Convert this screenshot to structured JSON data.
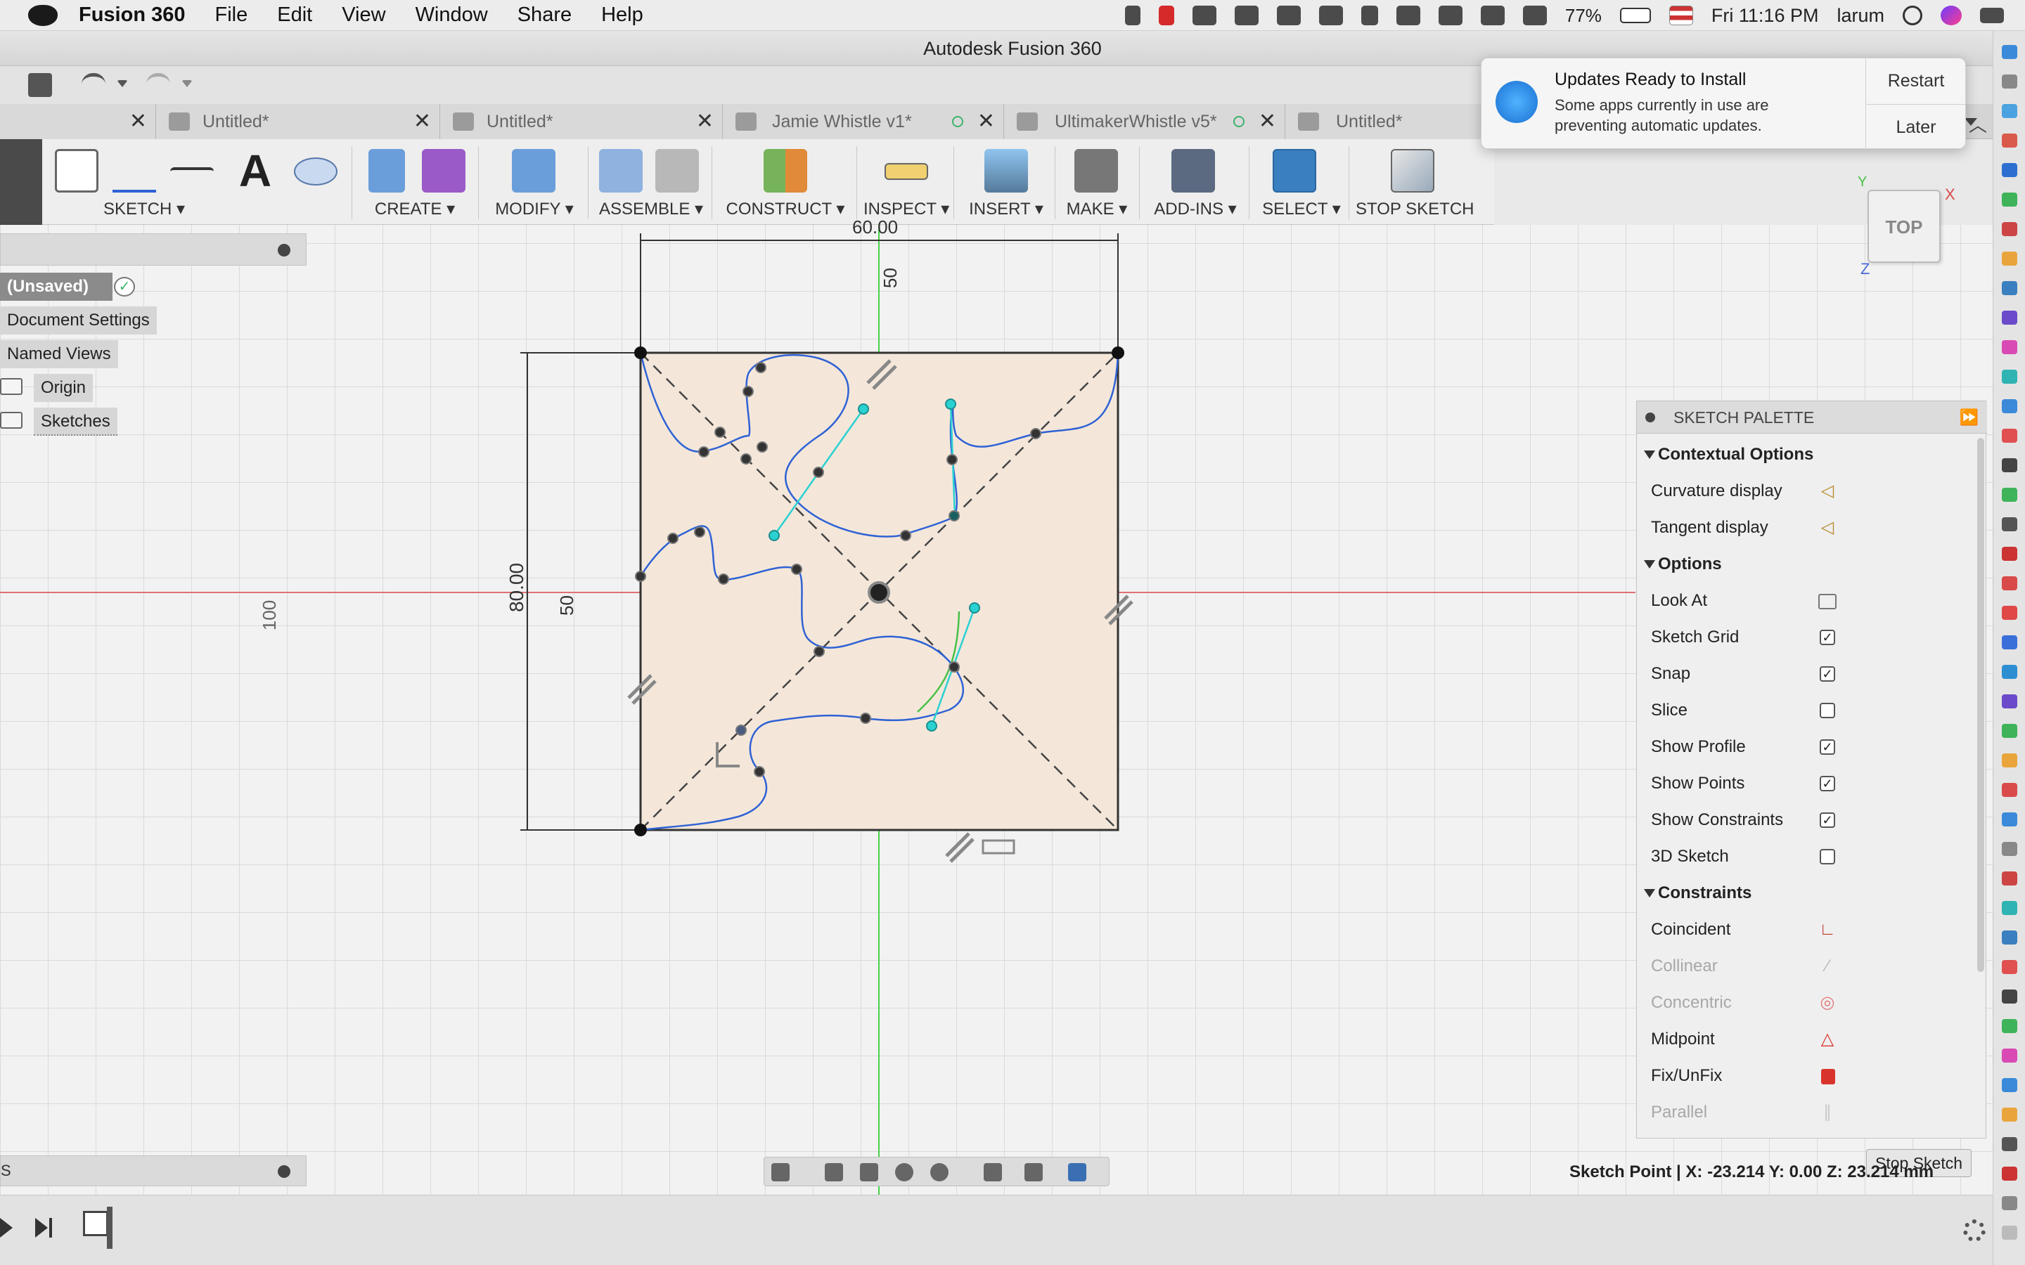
{
  "menubar": {
    "app": "Fusion 360",
    "items": [
      "File",
      "Edit",
      "View",
      "Window",
      "Share",
      "Help"
    ],
    "battery": "77%",
    "clock": "Fri 11:16 PM",
    "user": "larum"
  },
  "window": {
    "title": "Autodesk Fusion 360"
  },
  "tabs": [
    {
      "label": "Untitled*"
    },
    {
      "label": "Untitled*"
    },
    {
      "label": "Jamie Whistle v1*"
    },
    {
      "label": "UltimakerWhistle v5*"
    },
    {
      "label": "Untitled*"
    }
  ],
  "ribbon": {
    "groups": [
      "SKETCH ▾",
      "CREATE ▾",
      "MODIFY ▾",
      "ASSEMBLE ▾",
      "CONSTRUCT ▾",
      "INSPECT ▾",
      "INSERT ▾",
      "MAKE ▾",
      "ADD-INS ▾",
      "SELECT ▾",
      "STOP SKETCH"
    ]
  },
  "notification": {
    "title": "Updates Ready to Install",
    "body": "Some apps currently in use are preventing automatic updates.",
    "restart": "Restart",
    "later": "Later"
  },
  "browser": {
    "doc": "(Unsaved)",
    "items": [
      "Document Settings",
      "Named Views",
      "Origin",
      "Sketches"
    ]
  },
  "viewcube": {
    "face": "TOP",
    "axis_x": "X",
    "axis_y": "Y",
    "axis_z": "Z"
  },
  "dimensions": {
    "top_width": "60.00",
    "top_50": "50",
    "left_height": "80.00",
    "left_50": "50",
    "left_100": "100"
  },
  "palette": {
    "title": "SKETCH PALETTE",
    "sections": [
      {
        "title": "Contextual Options"
      },
      {
        "title": "Options"
      },
      {
        "title": "Constraints"
      }
    ],
    "contextual": [
      {
        "label": "Curvature display",
        "icon": "curvature-icon"
      },
      {
        "label": "Tangent display",
        "icon": "tangent-icon"
      }
    ],
    "options": [
      {
        "label": "Look At",
        "type": "button"
      },
      {
        "label": "Sketch Grid",
        "checked": true
      },
      {
        "label": "Snap",
        "checked": true
      },
      {
        "label": "Slice",
        "checked": false
      },
      {
        "label": "Show Profile",
        "checked": true
      },
      {
        "label": "Show Points",
        "checked": true
      },
      {
        "label": "Show Constraints",
        "checked": true
      },
      {
        "label": "3D Sketch",
        "checked": false
      }
    ],
    "constraints": [
      {
        "label": "Coincident",
        "enabled": true,
        "color": "#c0392b"
      },
      {
        "label": "Collinear",
        "enabled": false,
        "color": "#b9b9b9"
      },
      {
        "label": "Concentric",
        "enabled": false,
        "color": "#e27a7a"
      },
      {
        "label": "Midpoint",
        "enabled": true,
        "color": "#d9342b"
      },
      {
        "label": "Fix/UnFix",
        "enabled": true,
        "color": "#d9342b"
      },
      {
        "label": "Parallel",
        "enabled": false,
        "color": "#c9c9c9"
      }
    ],
    "stop_sketch": "Stop Sketch"
  },
  "status": {
    "text": "Sketch Point | X: -23.214 Y: 0.00 Z: 23.214 mm",
    "bottom_panel_label": "S"
  },
  "colors": {
    "accent": "#3a7fbf",
    "spline": "#2f62d4",
    "handle": "#2ad1d1",
    "profile_fill": "#f4e7da",
    "x_axis": "#e07070",
    "y_axis": "#47d247"
  }
}
